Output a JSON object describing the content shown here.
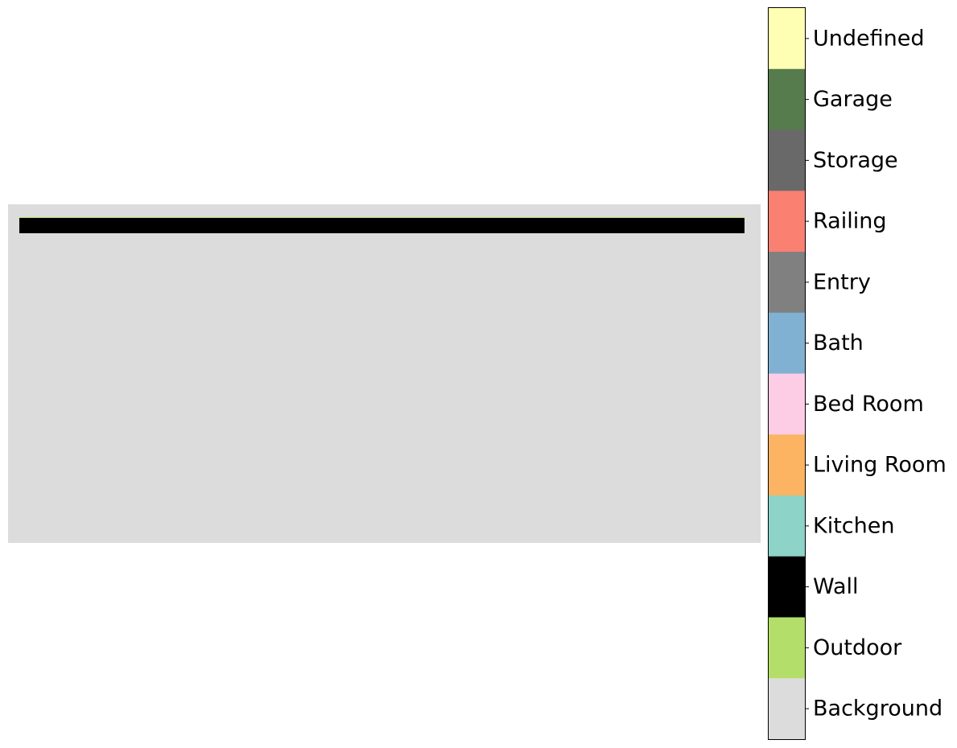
{
  "plan": {
    "regions": [
      {
        "label": "Background",
        "role": "image-background"
      },
      {
        "label": "Wall",
        "role": "wall-segment"
      }
    ]
  },
  "legend": {
    "items": [
      {
        "label": "Undefined",
        "color": "#ffffb3"
      },
      {
        "label": "Garage",
        "color": "#567b4c"
      },
      {
        "label": "Storage",
        "color": "#696969"
      },
      {
        "label": "Railing",
        "color": "#fa8072"
      },
      {
        "label": "Entry",
        "color": "#808080"
      },
      {
        "label": "Bath",
        "color": "#80b1d3"
      },
      {
        "label": "Bed Room",
        "color": "#fccde5"
      },
      {
        "label": "Living Room",
        "color": "#fdb462"
      },
      {
        "label": "Kitchen",
        "color": "#8dd3c7"
      },
      {
        "label": "Wall",
        "color": "#000000"
      },
      {
        "label": "Outdoor",
        "color": "#b3de69"
      },
      {
        "label": "Background",
        "color": "#dcdcdc"
      }
    ]
  }
}
